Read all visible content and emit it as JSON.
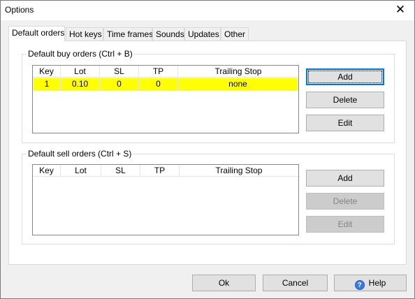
{
  "window": {
    "title": "Options"
  },
  "tabs": [
    "Default orders",
    "Hot keys",
    "Time frames",
    "Sounds",
    "Updates",
    "Other"
  ],
  "buy_group": {
    "label": "Default buy orders (Ctrl + B)",
    "columns": [
      "Key",
      "Lot",
      "SL",
      "TP",
      "Trailing Stop"
    ],
    "rows": [
      {
        "key": "1",
        "lot": "0.10",
        "sl": "0",
        "tp": "0",
        "trailing": "none"
      }
    ],
    "add": "Add",
    "delete": "Delete",
    "edit": "Edit"
  },
  "sell_group": {
    "label": "Default sell orders (Ctrl + S)",
    "columns": [
      "Key",
      "Lot",
      "SL",
      "TP",
      "Trailing Stop"
    ],
    "rows": [],
    "add": "Add",
    "delete": "Delete",
    "edit": "Edit"
  },
  "footer": {
    "ok": "Ok",
    "cancel": "Cancel",
    "help": "Help"
  },
  "colors": {
    "selected_row": "#ffff00",
    "focus_border": "#0078d7"
  }
}
